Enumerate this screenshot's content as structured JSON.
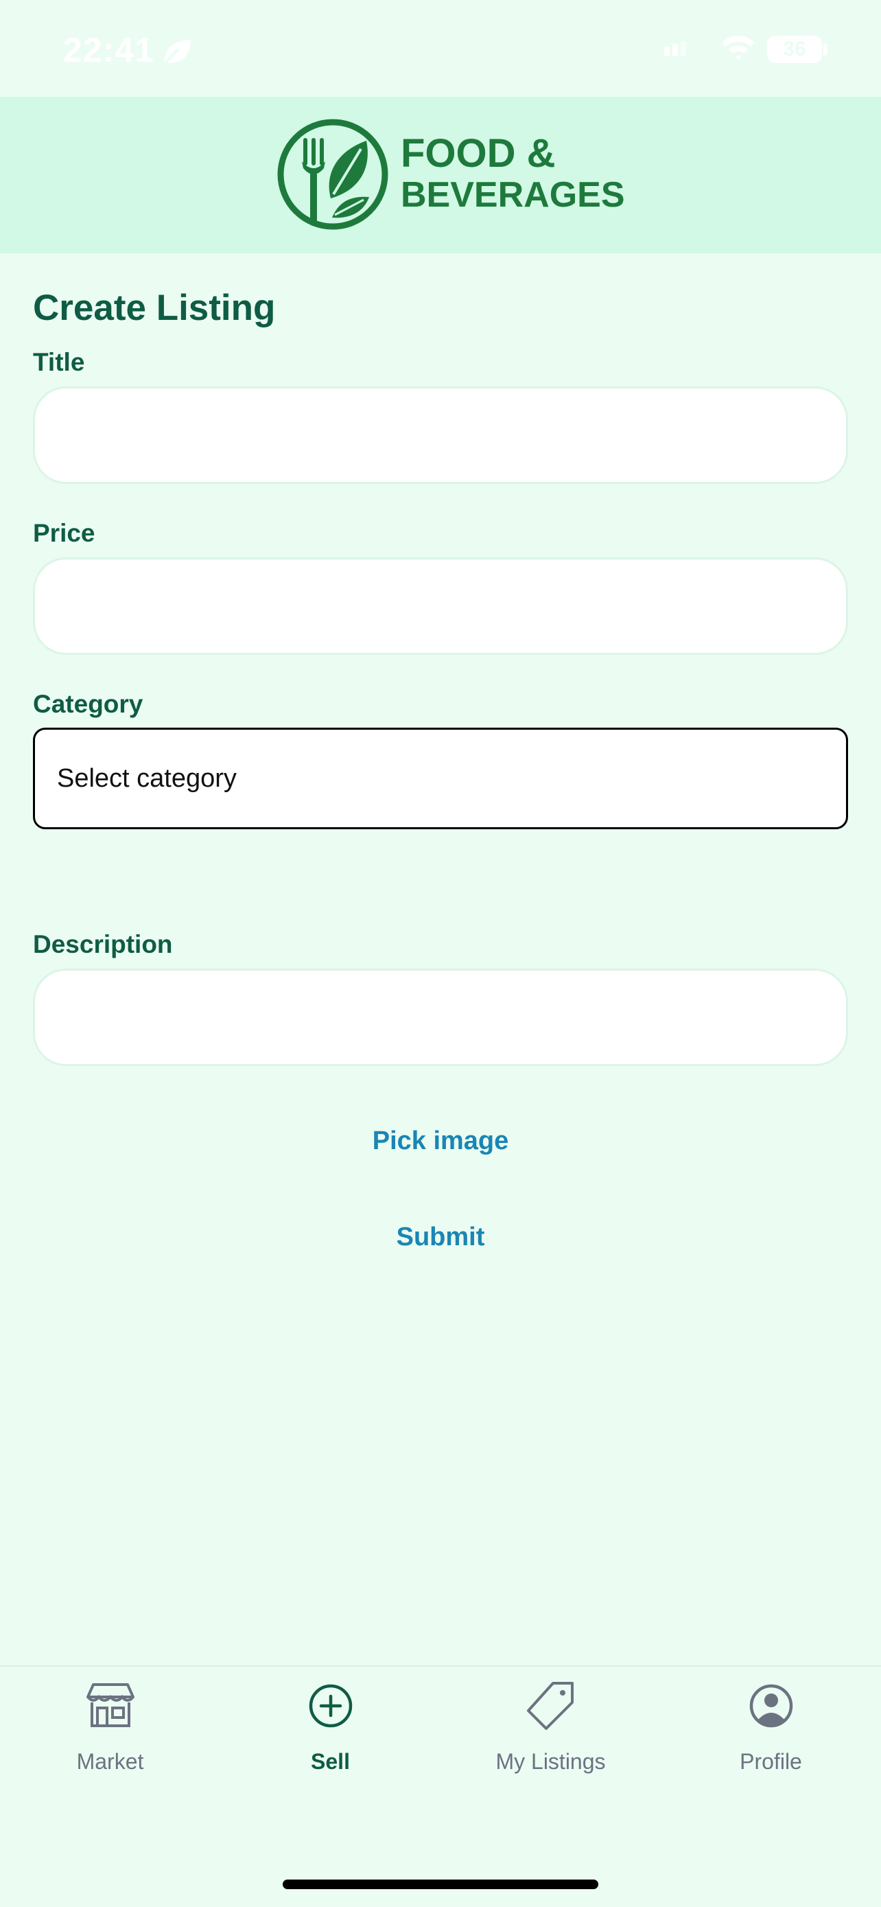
{
  "status_bar": {
    "time": "22:41",
    "battery": "36",
    "icons": [
      "leaf-icon",
      "signal-icon",
      "wifi-icon",
      "battery-icon"
    ]
  },
  "header": {
    "brand_line1": "FOOD &",
    "brand_line2": "BEVERAGES",
    "logo_icon": "fork-leaf-logo-icon",
    "colors": {
      "brand": "#1e7a3c",
      "background": "#d1f9e5"
    }
  },
  "form": {
    "title": "Create Listing",
    "title_field": {
      "label": "Title",
      "value": "",
      "placeholder": ""
    },
    "price_field": {
      "label": "Price",
      "value": "",
      "placeholder": ""
    },
    "category_field": {
      "label": "Category",
      "selected": "Select category"
    },
    "description_field": {
      "label": "Description",
      "value": "",
      "placeholder": ""
    },
    "pick_image_label": "Pick image",
    "submit_label": "Submit",
    "colors": {
      "label": "#0f5c44",
      "link": "#1a86b3",
      "page_background": "#ebfcf3"
    }
  },
  "tab_bar": {
    "tabs": [
      {
        "label": "Market",
        "icon": "storefront-icon",
        "active": false
      },
      {
        "label": "Sell",
        "icon": "plus-circle-icon",
        "active": true
      },
      {
        "label": "My Listings",
        "icon": "tag-icon",
        "active": false
      },
      {
        "label": "Profile",
        "icon": "user-circle-icon",
        "active": false
      }
    ]
  }
}
